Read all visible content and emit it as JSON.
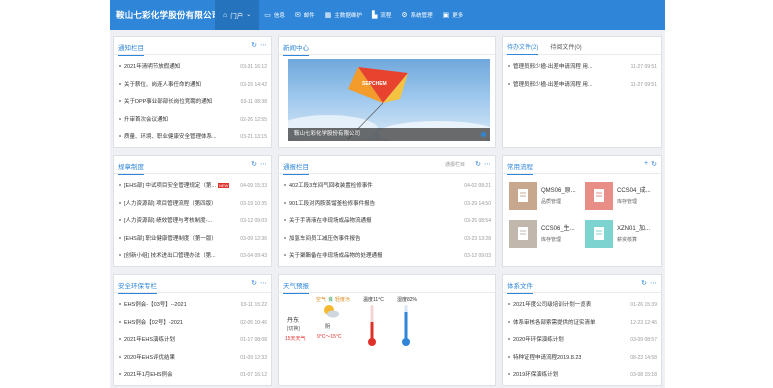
{
  "app": {
    "brand": "鞍山七彩化学股份有限公司"
  },
  "nav": {
    "items": [
      {
        "label": "门户",
        "icon": "home-icon"
      },
      {
        "label": "信息",
        "icon": "message-icon"
      },
      {
        "label": "邮件",
        "icon": "mail-icon"
      },
      {
        "label": "主数据维护",
        "icon": "calendar-icon"
      },
      {
        "label": "流程",
        "icon": "flow-icon"
      },
      {
        "label": "系统管理",
        "icon": "gear-icon"
      },
      {
        "label": "更多",
        "icon": "grid-icon"
      }
    ]
  },
  "notice": {
    "title": "通知栏目",
    "rows": [
      {
        "text": "2021年清明节放假通知",
        "date": "03-31 16:12"
      },
      {
        "text": "关于薪位、岗连人事任命的通知",
        "date": "03-15 14:42"
      },
      {
        "text": "关于DPP事业部部长岗位竞聘的通知",
        "date": "03-11 08:38"
      },
      {
        "text": "升审首次会议通知",
        "date": "02-26 12:55"
      },
      {
        "text": "质量、环境、职业健康安全管理体系...",
        "date": "03-21 13:15"
      }
    ]
  },
  "news": {
    "title": "新闻中心",
    "caption": "鞍山七彩化学股份有限公司"
  },
  "todo": {
    "tab_active": "待办文件(2)",
    "tab_inactive": "待阅文件(0)",
    "rows": [
      {
        "text": "管理员邢少楹-出差申请流程 用...",
        "date": "11-27 09:51"
      },
      {
        "text": "管理员邢少楹-出差申请流程 用...",
        "date": "11-27 09:51"
      }
    ]
  },
  "rules": {
    "title": "规章制度",
    "new_badge": "NEW",
    "rows": [
      {
        "text": "[EHS部] 中试项目安全管理规定（第...",
        "date": "04-09 15:33",
        "is_new": true
      },
      {
        "text": "[人力资源部] 项目管理流程（第四版）",
        "date": "03-19 10:35",
        "is_new": false
      },
      {
        "text": "[人力资源部] 绩效管理与考核制度-...",
        "date": "03-12 09:03",
        "is_new": false
      },
      {
        "text": "[EHS部] 职业健康管理制度（第一版）",
        "date": "03-09 12:36",
        "is_new": false
      },
      {
        "text": "[创新小组] 技术进出口管理办法（第...",
        "date": "03-04 09:43",
        "is_new": false
      }
    ]
  },
  "bulletin": {
    "title": "通报栏目",
    "extra": "通报栏目",
    "rows": [
      {
        "text": "402工段3车间气回收装置检修事件",
        "date": "04-02 08:21"
      },
      {
        "text": "901工段对丙胺蒸馏釜检修事件报告",
        "date": "03-29 14:50"
      },
      {
        "text": "关于手清液在非现场成品物流通报",
        "date": "03-25 08:54"
      },
      {
        "text": "加氢车间员工减压伤事件报告",
        "date": "03-23 13:28"
      },
      {
        "text": "关于聚酯备在非现场成品物的处理通报",
        "date": "03-12 09:03"
      }
    ]
  },
  "flows": {
    "title": "常用流程",
    "items": [
      {
        "title": "QMS06_原...",
        "sub": "品质管理",
        "color": "#c8a78f"
      },
      {
        "title": "CCS04_成...",
        "sub": "库存管理",
        "color": "#e98e86"
      },
      {
        "title": "CCS06_生...",
        "sub": "库存管理",
        "color": "#c2b7ad"
      },
      {
        "title": "XZN01_加...",
        "sub": "薪资核算",
        "color": "#7dd3cf"
      }
    ]
  },
  "safety": {
    "title": "安全环保专栏",
    "rows": [
      {
        "text": "EHS例会-【03号】--2021",
        "date": "03-11 15:22"
      },
      {
        "text": "EHS例会【02号】-2021",
        "date": "02-05 10:46"
      },
      {
        "text": "2021年EHS演练计划",
        "date": "01-17 08:08"
      },
      {
        "text": "2020年EHS评优结果",
        "date": "01-09 12:33"
      },
      {
        "text": "2021年1月EHS例会",
        "date": "01-07 16:12"
      }
    ]
  },
  "weather": {
    "title": "天气预报",
    "city": "丹东",
    "city_sub": "[切换]",
    "days": "15天天气",
    "aqi_label": "空气",
    "aqi_value": "良",
    "aqi_level": "轻度污",
    "condition": "阴",
    "temp_range": "9°C～15°C",
    "temp_label": "温度11°C",
    "humidity_label": "湿度82%"
  },
  "system_files": {
    "title": "体系文件",
    "rows": [
      {
        "text": "2021年度公司级培训计划一览表",
        "date": "01-26 15:39"
      },
      {
        "text": "体系审核各部索需提供的证实清单",
        "date": "12-23 12:46"
      },
      {
        "text": "2020年环保演练计划",
        "date": "03-09 08:57"
      },
      {
        "text": "特种证程申请流程2019.8.23",
        "date": "08-23 14:58"
      },
      {
        "text": "2019环保演练计划",
        "date": "03-08 15:18"
      }
    ]
  }
}
